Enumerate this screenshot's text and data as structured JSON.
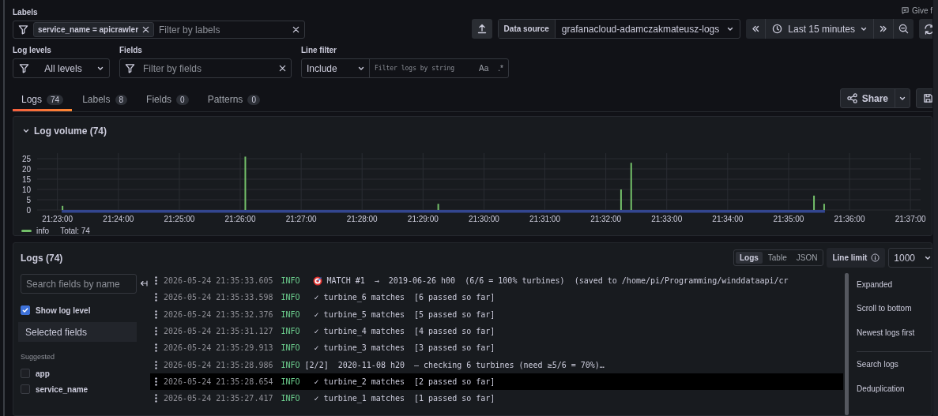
{
  "feedback_link": "Give f",
  "labels_filter": {
    "label": "Labels",
    "chips": [
      {
        "text": "service_name = apicrawler"
      }
    ],
    "placeholder": "Filter by labels"
  },
  "data_source": {
    "label": "Data source",
    "value": "grafanacloud-adamczakmateusz-logs"
  },
  "time_range": {
    "value": "Last 15 minutes"
  },
  "log_levels": {
    "label": "Log levels",
    "value": "All levels"
  },
  "fields_filter": {
    "label": "Fields",
    "placeholder": "Filter by fields"
  },
  "line_filter": {
    "label": "Line filter",
    "mode": "Include",
    "placeholder": "Filter logs by string",
    "match_case": "Aa",
    "regex": ".*"
  },
  "tabs": [
    {
      "label": "Logs",
      "count": "74",
      "selected": true
    },
    {
      "label": "Labels",
      "count": "8",
      "selected": false
    },
    {
      "label": "Fields",
      "count": "0",
      "selected": false
    },
    {
      "label": "Patterns",
      "count": "0",
      "selected": false
    }
  ],
  "share": {
    "label": "Share"
  },
  "log_volume": {
    "title": "Log volume (74)",
    "expanded": true,
    "total": "Total: 74",
    "chart_data": {
      "type": "bar",
      "categories": [
        null,
        null,
        "21:23:00",
        null,
        null,
        null,
        null,
        null,
        "21:24:00",
        null,
        null,
        null,
        null,
        null,
        "21:25:00",
        null,
        null,
        null,
        null,
        null,
        "21:26:00",
        null,
        null,
        null,
        null,
        null,
        "21:27:00",
        null,
        null,
        null,
        null,
        null,
        "21:28:00",
        null,
        null,
        null,
        null,
        null,
        "21:29:00",
        null,
        null,
        null,
        null,
        null,
        "21:30:00",
        null,
        null,
        null,
        null,
        null,
        "21:31:00",
        null,
        null,
        null,
        null,
        null,
        "21:32:00",
        null,
        null,
        null,
        null,
        null,
        "21:33:00",
        null,
        null,
        null,
        null,
        null,
        "21:34:00",
        null,
        null,
        null,
        null,
        null,
        "21:35:00",
        null,
        null,
        null,
        null,
        null,
        "21:36:00",
        null,
        null,
        null,
        null,
        null,
        "21:37:00"
      ],
      "series": [
        {
          "name": "info",
          "color": "#73bf69",
          "values": [
            null,
            null,
            2,
            null,
            null,
            null,
            null,
            null,
            null,
            null,
            null,
            null,
            null,
            null,
            null,
            null,
            null,
            null,
            null,
            null,
            26,
            null,
            null,
            null,
            null,
            null,
            null,
            null,
            null,
            null,
            null,
            null,
            null,
            null,
            null,
            null,
            null,
            null,
            null,
            3,
            null,
            null,
            null,
            null,
            null,
            null,
            null,
            null,
            null,
            null,
            null,
            null,
            null,
            null,
            null,
            null,
            null,
            10,
            23,
            null,
            null,
            null,
            null,
            null,
            null,
            null,
            null,
            null,
            null,
            null,
            null,
            null,
            null,
            null,
            null,
            null,
            7,
            3,
            null,
            null,
            null,
            null,
            null,
            null,
            null,
            null,
            null
          ]
        }
      ],
      "ylim": [
        0,
        27.7
      ],
      "grid": true,
      "yticks": [
        0,
        5,
        10,
        15,
        20,
        25
      ]
    }
  },
  "logs_panel": {
    "title": "Logs (74)",
    "views": [
      {
        "label": "Logs",
        "selected": true
      },
      {
        "label": "Table",
        "selected": false
      },
      {
        "label": "JSON",
        "selected": false
      }
    ],
    "line_limit": {
      "label": "Line limit",
      "value": "1000"
    },
    "field_search": {
      "placeholder": "Search fields by name"
    },
    "show_log_level": {
      "label": "Show log level",
      "checked": true
    },
    "selected_fields": {
      "label": "Selected fields"
    },
    "suggested": {
      "label": "Suggested",
      "fields": [
        {
          "label": "app",
          "checked": false
        },
        {
          "label": "service_name",
          "checked": false
        }
      ]
    },
    "rows": [
      {
        "kind": "match",
        "time": "2026-05-24 21:35:33.605",
        "level": "INFO",
        "message": "MATCH #1  →  2019-06-26 h00  (6/6 = 100% turbines)  (saved to /home/pi/Programming/winddataapi/cr",
        "selected": false
      },
      {
        "kind": "check",
        "time": "2026-05-24 21:35:33.598",
        "level": "INFO",
        "message": "✓ turbine_6 matches  [6 passed so far]",
        "selected": false
      },
      {
        "kind": "check",
        "time": "2026-05-24 21:35:32.376",
        "level": "INFO",
        "message": "✓ turbine_5 matches  [5 passed so far]",
        "selected": false
      },
      {
        "kind": "check",
        "time": "2026-05-24 21:35:31.127",
        "level": "INFO",
        "message": "✓ turbine_4 matches  [4 passed so far]",
        "selected": false
      },
      {
        "kind": "check",
        "time": "2026-05-24 21:35:29.913",
        "level": "INFO",
        "message": "✓ turbine_3 matches  [3 passed so far]",
        "selected": false
      },
      {
        "kind": "plain",
        "time": "2026-05-24 21:35:28.986",
        "level": "INFO",
        "message": "[2/2]  2020-11-08 h20  – checking 6 turbines (need ≥5/6 = 70%)…",
        "selected": false
      },
      {
        "kind": "check",
        "time": "2026-05-24 21:35:28.654",
        "level": "INFO",
        "message": "✓ turbine_2 matches  [2 passed so far]",
        "selected": true
      },
      {
        "kind": "check",
        "time": "2026-05-24 21:35:27.417",
        "level": "INFO",
        "message": "✓ turbine_1 matches  [1 passed so far]",
        "selected": false
      }
    ],
    "options": [
      [
        "Expanded",
        "Scroll to bottom",
        "Newest logs first"
      ],
      [
        "Search logs",
        "Deduplication"
      ]
    ]
  }
}
